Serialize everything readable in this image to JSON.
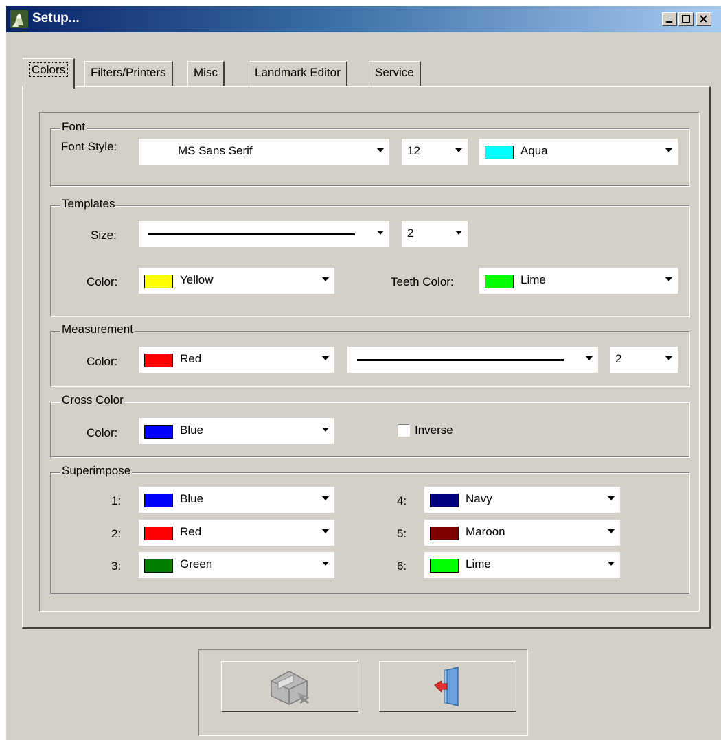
{
  "window": {
    "title": "Setup...",
    "controls": {
      "minimize": "minimize",
      "maximize": "maximize",
      "close": "close"
    }
  },
  "tabs": [
    {
      "label": "Colors",
      "active": true
    },
    {
      "label": "Filters/Printers",
      "active": false
    },
    {
      "label": "Misc",
      "active": false
    },
    {
      "label": "Landmark Editor",
      "active": false
    },
    {
      "label": "Service",
      "active": false
    }
  ],
  "font": {
    "group_label": "Font",
    "style_label": "Font Style:",
    "style_value": "MS Sans Serif",
    "size_value": "12",
    "color_value": "Aqua",
    "color_hex": "#00ffff"
  },
  "templates": {
    "group_label": "Templates",
    "size_label": "Size:",
    "size_value": "2",
    "color_label": "Color:",
    "color_value": "Yellow",
    "color_hex": "#ffff00",
    "teeth_label": "Teeth Color:",
    "teeth_value": "Lime",
    "teeth_hex": "#00ff00"
  },
  "measurement": {
    "group_label": "Measurement",
    "color_label": "Color:",
    "color_value": "Red",
    "color_hex": "#ff0000",
    "width_value": "2"
  },
  "cross": {
    "group_label": "Cross Color",
    "color_label": "Color:",
    "color_value": "Blue",
    "color_hex": "#0000ff",
    "inverse_label": "Inverse",
    "inverse_checked": false
  },
  "superimpose": {
    "group_label": "Superimpose",
    "items": [
      {
        "index": "1:",
        "value": "Blue",
        "hex": "#0000ff"
      },
      {
        "index": "2:",
        "value": "Red",
        "hex": "#ff0000"
      },
      {
        "index": "3:",
        "value": "Green",
        "hex": "#008000"
      },
      {
        "index": "4:",
        "value": "Navy",
        "hex": "#000080"
      },
      {
        "index": "5:",
        "value": "Maroon",
        "hex": "#800000"
      },
      {
        "index": "6:",
        "value": "Lime",
        "hex": "#00ff00"
      }
    ]
  },
  "buttons": {
    "save_icon": "disk-save-icon",
    "exit_icon": "exit-door-icon"
  },
  "colors": {
    "window_bg": "#d4d0c8",
    "titlebar_start": "#0a246a",
    "titlebar_end": "#a6caf0"
  }
}
